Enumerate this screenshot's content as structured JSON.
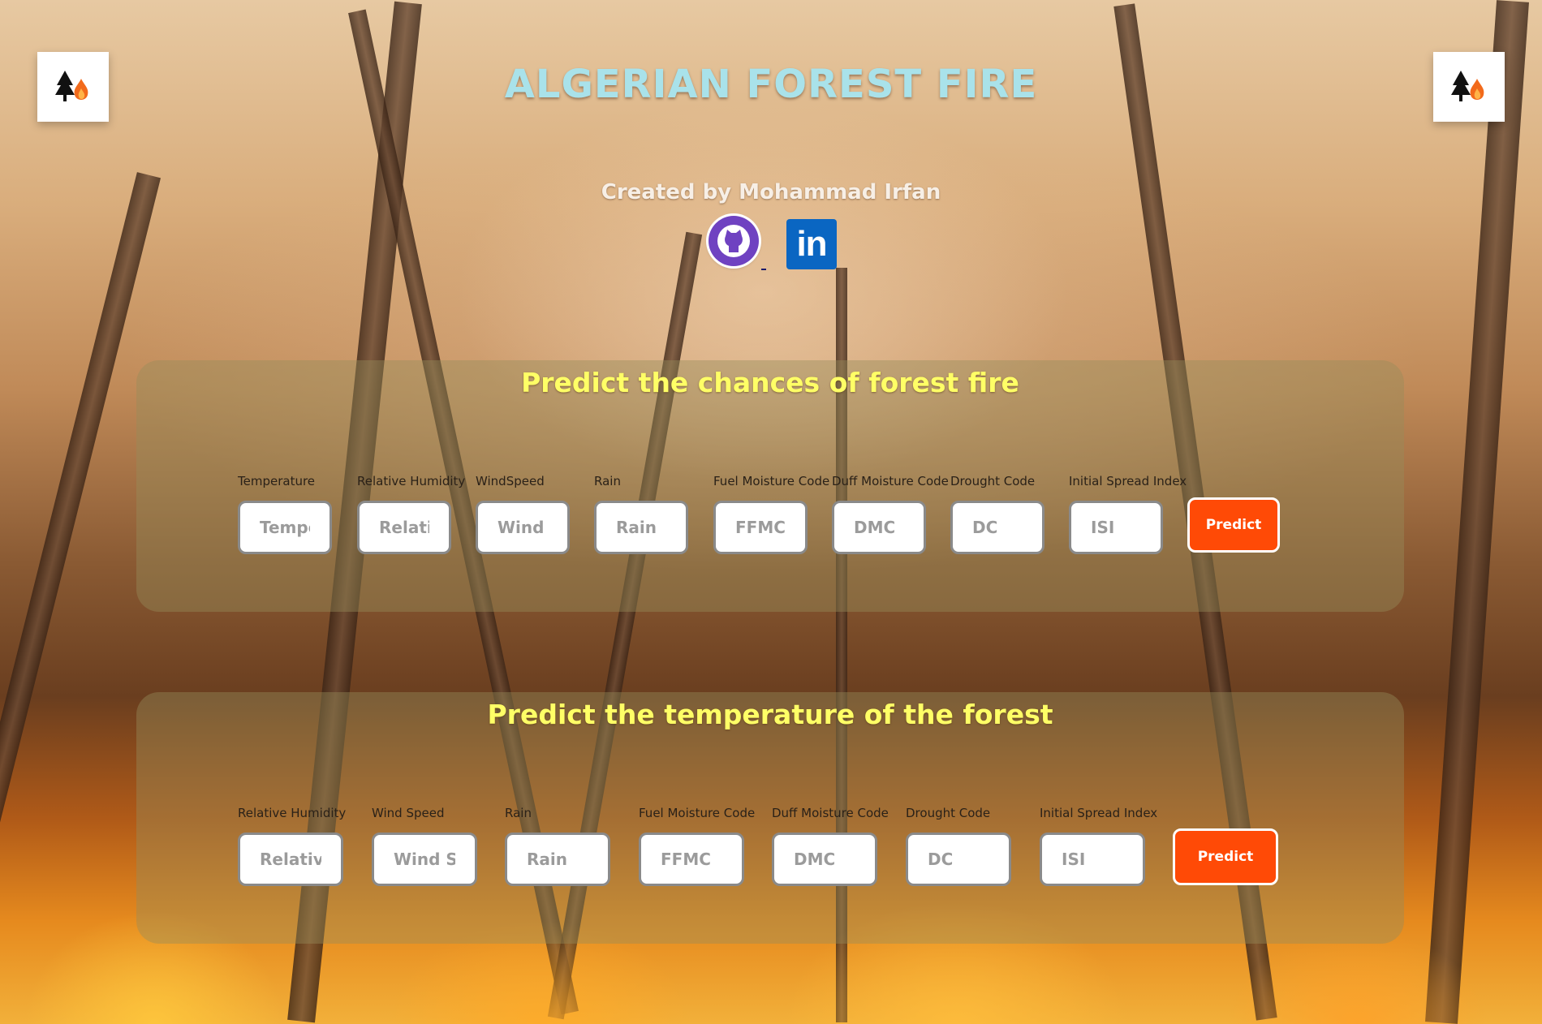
{
  "header": {
    "title": "ALGERIAN FOREST FIRE",
    "created_by": "Created by Mohammad Irfan",
    "social": {
      "github_icon": "github-icon",
      "linkedin_icon": "linkedin-icon",
      "linkedin_text": "in"
    },
    "logo_icon": "tree-fire-icon"
  },
  "fire_panel": {
    "heading": "Predict the chances of forest fire",
    "fields": [
      {
        "label": "Temperature",
        "placeholder": "Temperature"
      },
      {
        "label": "Relative Humidity",
        "placeholder": "Relative Humidity"
      },
      {
        "label": "WindSpeed",
        "placeholder": "Wind speed"
      },
      {
        "label": "Rain",
        "placeholder": "Rain"
      },
      {
        "label": "Fuel Moisture Code",
        "placeholder": "FFMC"
      },
      {
        "label": "Duff Moisture Code",
        "placeholder": "DMC"
      },
      {
        "label": "Drought Code",
        "placeholder": "DC"
      },
      {
        "label": "Initial Spread Index",
        "placeholder": "ISI"
      }
    ],
    "button_label": "Predict"
  },
  "temp_panel": {
    "heading": "Predict the temperature of the forest",
    "fields": [
      {
        "label": "Relative Humidity",
        "placeholder": "Relative Humidity"
      },
      {
        "label": "Wind Speed",
        "placeholder": "Wind Speed"
      },
      {
        "label": "Rain",
        "placeholder": "Rain"
      },
      {
        "label": "Fuel Moisture Code",
        "placeholder": "FFMC"
      },
      {
        "label": "Duff Moisture Code",
        "placeholder": "DMC"
      },
      {
        "label": "Drought Code",
        "placeholder": "DC"
      },
      {
        "label": "Initial Spread Index",
        "placeholder": "ISI"
      }
    ],
    "button_label": "Predict"
  },
  "colors": {
    "title": "#a9e2ea",
    "heading": "#ffff66",
    "button": "#ff4a06"
  }
}
